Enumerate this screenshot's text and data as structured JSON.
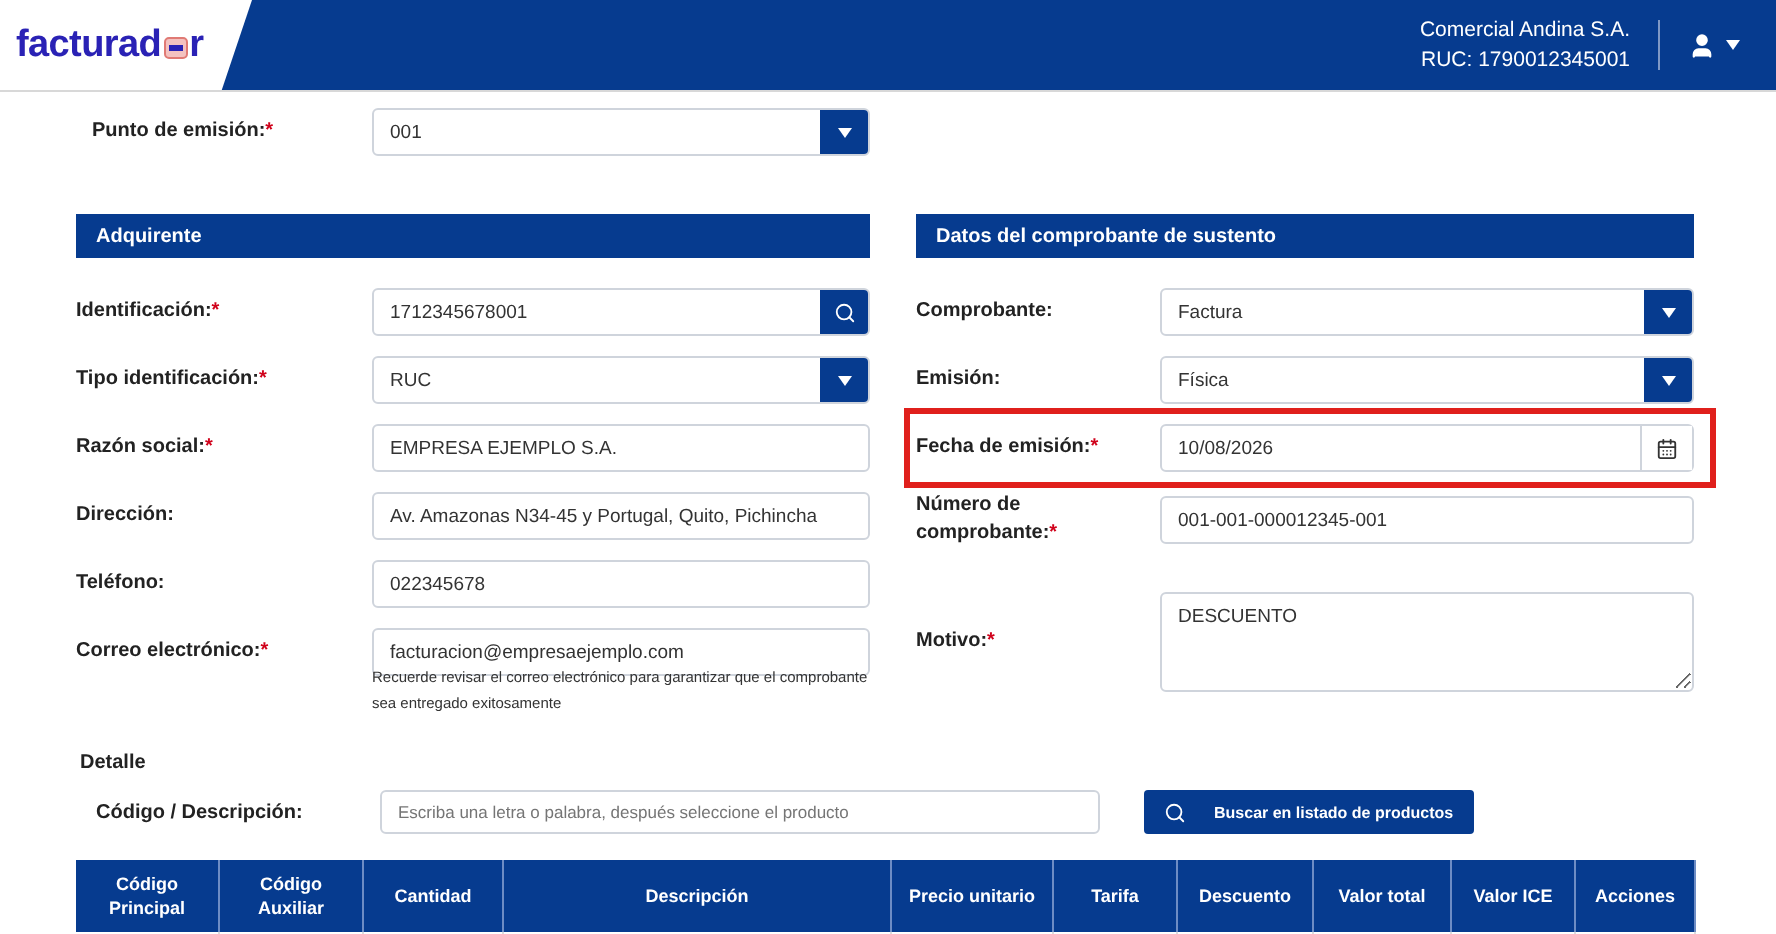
{
  "header": {
    "logo": [
      "facturad",
      "r"
    ],
    "company": "Comercial Andina S.A.",
    "ruc": "RUC: 1790012345001"
  },
  "punto": {
    "label": "Punto de emisión:",
    "mark": "*",
    "kind": "select",
    "value": "001"
  },
  "sections": [
    {
      "title": "Adquirente",
      "fields": [
        {
          "label": "Identificación:",
          "mark": "*",
          "kind": "search",
          "value": "1712345678001",
          "highlighted": false
        },
        {
          "label": "Tipo identificación:",
          "mark": "*",
          "kind": "select",
          "value": "RUC",
          "highlighted": false
        },
        {
          "label": "Razón social:",
          "mark": "*",
          "kind": "text",
          "value": "EMPRESA EJEMPLO S.A.",
          "highlighted": false
        },
        {
          "label": "Dirección:",
          "kind": "text",
          "value": "Av. Amazonas N34-45 y Portugal, Quito, Pichincha",
          "highlighted": false
        },
        {
          "label": "Teléfono:",
          "kind": "text",
          "value": "022345678",
          "highlighted": false
        },
        {
          "label": "Correo electrónico:",
          "mark": "*",
          "kind": "text",
          "value": "facturacion@empresaejemplo.com",
          "help": "Recuerde revisar el correo electrónico para garantizar que el comprobante sea entregado exitosamente",
          "highlighted": false
        }
      ]
    },
    {
      "title": "Datos del comprobante de sustento",
      "fields": [
        {
          "label": "Comprobante:",
          "kind": "select",
          "value": "Factura",
          "highlighted": false
        },
        {
          "label": "Emisión:",
          "kind": "select",
          "value": "Física",
          "highlighted": false
        },
        {
          "label": "Fecha de emisión:",
          "mark": "*",
          "kind": "date",
          "value": "10/08/2026",
          "highlighted": true
        },
        {
          "label": "Número de comprobante:",
          "mark": "*",
          "kind": "text",
          "value": "001-001-000012345-001",
          "highlighted": false
        },
        {
          "label": "Motivo:",
          "mark": "*",
          "kind": "textarea",
          "value": "DESCUENTO",
          "highlighted": false
        }
      ]
    }
  ],
  "detalle": {
    "title": "Detalle",
    "search_label": "Código / Descripción:",
    "placeholder": "Escriba una letra o palabra, después seleccione el producto",
    "button": "Buscar en listado de productos",
    "columns": [
      "Código Principal",
      "Código Auxiliar",
      "Cantidad",
      "Descripción",
      "Precio unitario",
      "Tarifa",
      "Descuento",
      "Valor total",
      "Valor ICE",
      "Acciones"
    ]
  }
}
